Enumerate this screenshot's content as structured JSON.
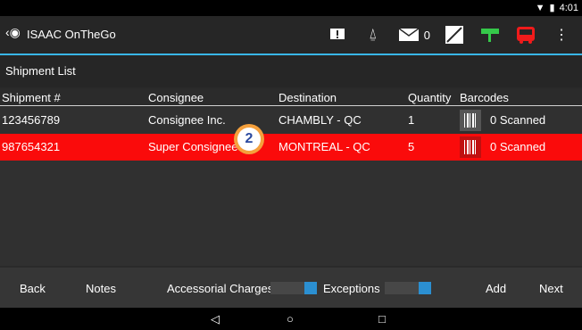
{
  "status": {
    "time": "4:01"
  },
  "appbar": {
    "title": "ISAAC OnTheGo",
    "mail_count": "0"
  },
  "page_title": "Shipment List",
  "table": {
    "headers": [
      "Shipment #",
      "Consignee",
      "Destination",
      "Quantity",
      "Barcodes"
    ],
    "rows": [
      {
        "shipment": "123456789",
        "consignee": "Consignee Inc.",
        "destination": "CHAMBLY - QC",
        "quantity": "1",
        "scanned": "0 Scanned"
      },
      {
        "shipment": "987654321",
        "consignee": "Super Consignee",
        "destination": "MONTREAL - QC",
        "quantity": "5",
        "scanned": "0 Scanned"
      }
    ]
  },
  "badge": "2",
  "bottom": {
    "back": "Back",
    "notes": "Notes",
    "accessorial": "Accessorial Charges",
    "exceptions": "Exceptions",
    "add": "Add",
    "next": "Next"
  },
  "nav": {
    "back": "◁",
    "home": "○",
    "recent": "□"
  },
  "colors": {
    "accent": "#39b6e8",
    "selected_row": "#fa0b0b",
    "badge": "#f5a03c"
  }
}
